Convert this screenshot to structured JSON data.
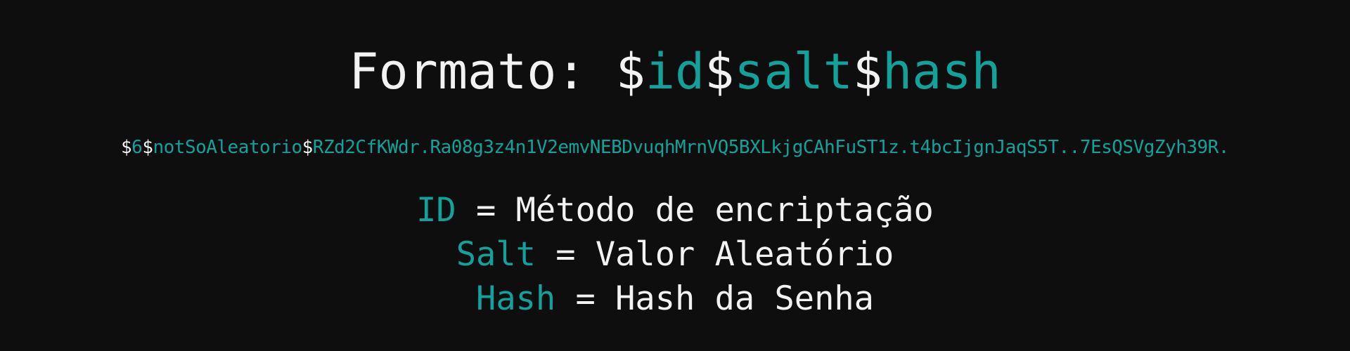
{
  "title": {
    "prefix": "Formato: ",
    "sep1": "$",
    "id": "id",
    "sep2": "$",
    "salt": "salt",
    "sep3": "$",
    "hash": "hash"
  },
  "example": {
    "sep1": "$",
    "id": "6",
    "sep2": "$",
    "salt": "notSoAleatorio",
    "sep3": "$",
    "hash": "RZd2CfKWdr.Ra08g3z4n1V2emvNEBDvuqhMrnVQ5BXLkjgCAhFuST1z.t4bcIjgnJaqS5T..7EsQSVgZyh39R."
  },
  "definitions": [
    {
      "term": "ID",
      "equals": " = ",
      "meaning": "Método de encriptação"
    },
    {
      "term": "Salt",
      "equals": " = ",
      "meaning": "Valor Aleatório"
    },
    {
      "term": "Hash",
      "equals": " = ",
      "meaning": "Hash da Senha"
    }
  ],
  "colors": {
    "background": "#0e0e0e",
    "text": "#f2f2f2",
    "accent": "#12a29a"
  }
}
